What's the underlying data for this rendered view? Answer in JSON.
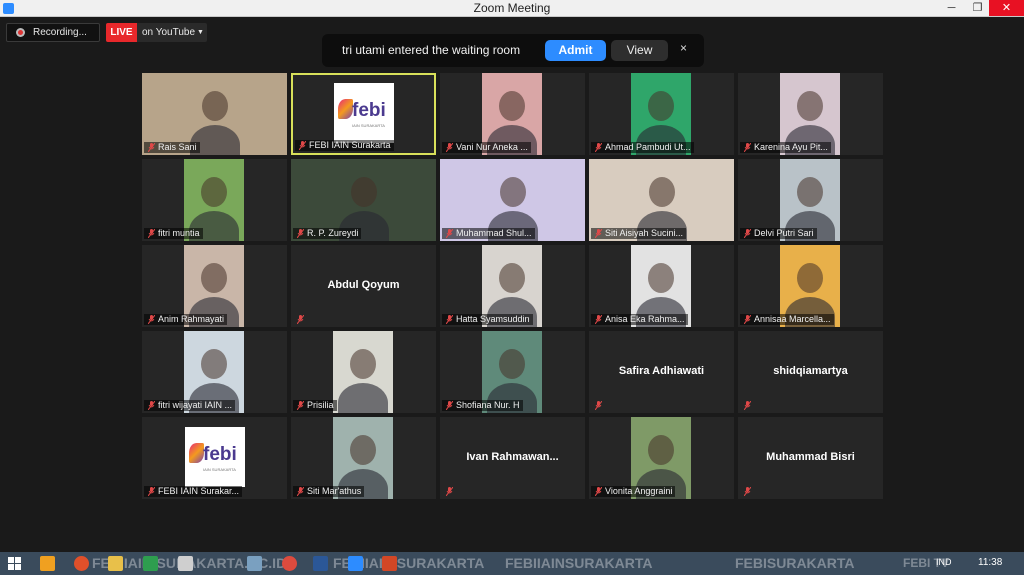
{
  "window": {
    "title": "Zoom Meeting"
  },
  "titlebar_controls": {
    "minimize": "─",
    "maximize": "❐",
    "close": "✕"
  },
  "recording": {
    "label": "Recording..."
  },
  "live": {
    "badge": "LIVE",
    "destination": "on YouTube",
    "caret": "▼"
  },
  "notification": {
    "message": "tri utami entered the waiting room",
    "admit_label": "Admit",
    "view_label": "View",
    "close_glyph": "×"
  },
  "participants": [
    {
      "name": "Rais Sani",
      "kind": "video",
      "bg": "#b7a48a"
    },
    {
      "name": "FEBI IAIN Surakarta",
      "kind": "logo",
      "active": true
    },
    {
      "name": "Vani Nur Aneka ...",
      "kind": "video",
      "bg": "#d9a6a6"
    },
    {
      "name": "Ahmad Pambudi Ut...",
      "kind": "video",
      "bg": "#2fa66a"
    },
    {
      "name": "Karenina Ayu Pit...",
      "kind": "video",
      "bg": "#d6c6cf"
    },
    {
      "name": "fitri muntia",
      "kind": "video",
      "bg": "#7aa85a"
    },
    {
      "name": "R. P. Zureydi",
      "kind": "video",
      "bg": "#3c4a3a"
    },
    {
      "name": "Muhammad Shul...",
      "kind": "video",
      "bg": "#cfc7e6"
    },
    {
      "name": "Siti Aisiyah Sucini...",
      "kind": "video",
      "bg": "#d8ccbf"
    },
    {
      "name": "Delvi Putri Sari",
      "kind": "video",
      "bg": "#b9c2c8"
    },
    {
      "name": "Anim Rahmayati",
      "kind": "video",
      "bg": "#c9b6a8"
    },
    {
      "name": "",
      "kind": "name",
      "center": "Abdul Qoyum"
    },
    {
      "name": "Hatta Syamsuddin",
      "kind": "video",
      "bg": "#d8d4cf"
    },
    {
      "name": "Anisa Eka Rahma...",
      "kind": "video",
      "bg": "#e2e2e2"
    },
    {
      "name": "Annisaa Marcella...",
      "kind": "video",
      "bg": "#e8b04a"
    },
    {
      "name": "fitri wijayati IAIN ...",
      "kind": "video",
      "bg": "#cdd7df"
    },
    {
      "name": "Prisilia",
      "kind": "video",
      "bg": "#d8d8d0"
    },
    {
      "name": "Shofiana Nur. H",
      "kind": "video",
      "bg": "#5f8a7a"
    },
    {
      "name": "",
      "kind": "name",
      "center": "Safira Adhiawati"
    },
    {
      "name": "",
      "kind": "name",
      "center": "shidqiamartya"
    },
    {
      "name": "FEBI IAIN Surakar...",
      "kind": "logo"
    },
    {
      "name": "Siti Mar'athus",
      "kind": "video",
      "bg": "#9fb2ad"
    },
    {
      "name": "",
      "kind": "name",
      "center": "Ivan Rahmawan..."
    },
    {
      "name": "Vionita Anggraini",
      "kind": "video",
      "bg": "#7f9a67"
    },
    {
      "name": "",
      "kind": "name",
      "center": "Muhammad Bisri"
    }
  ],
  "logo": {
    "text": "febi",
    "sub": "IAIN SURAKARTA"
  },
  "taskbar": {
    "watermarks": [
      "FEBIIAIN-SURAKARTA.AC.ID",
      "FEBIIAIN SURAKARTA",
      "FEBIIAINSURAKARTA",
      "FEBISURAKARTA",
      "FEBI TV"
    ],
    "language": "IND",
    "time": "11:38"
  }
}
